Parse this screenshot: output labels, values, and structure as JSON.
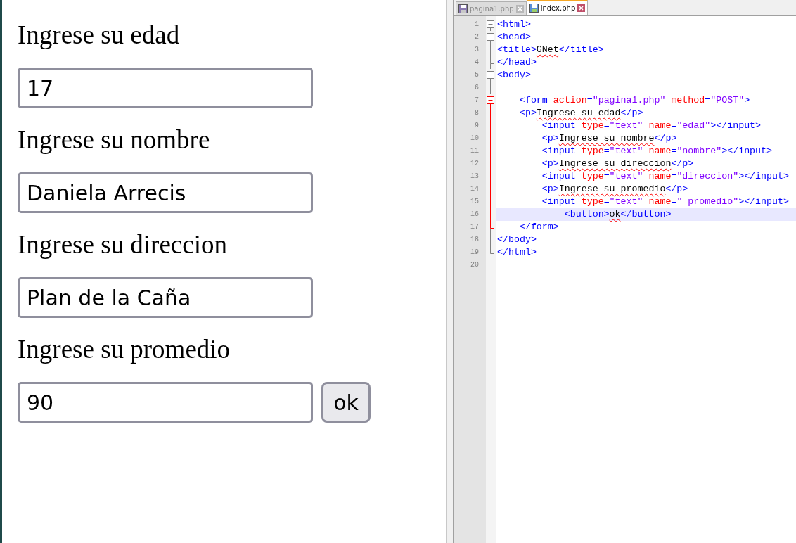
{
  "form": {
    "fields": [
      {
        "label": "Ingrese su edad",
        "value": "17"
      },
      {
        "label": "Ingrese su nombre",
        "value": "Daniela Arrecis"
      },
      {
        "label": "Ingrese su direccion",
        "value": "Plan de la Caña"
      },
      {
        "label": "Ingrese su promedio",
        "value": "90"
      }
    ],
    "button": "ok"
  },
  "editor": {
    "tabs": [
      {
        "label": "pagina1.php",
        "selected": false
      },
      {
        "label": "index.php",
        "selected": true
      }
    ],
    "lines": [
      {
        "number": "1",
        "kind": "fold-open",
        "color": "#808080",
        "selected": false,
        "tokens": [
          {
            "kind": "tag",
            "text": "<html>"
          }
        ]
      },
      {
        "number": "2",
        "kind": "fold-open",
        "color": "#808080",
        "selected": false,
        "tokens": [
          {
            "kind": "tag",
            "text": "<head>"
          }
        ]
      },
      {
        "number": "3",
        "kind": "fold-guide",
        "color": "#808080",
        "selected": false,
        "tokens": [
          {
            "kind": "tag",
            "text": "<title>"
          },
          {
            "kind": "text",
            "text": "GNet"
          },
          {
            "kind": "tag",
            "text": "</title>"
          }
        ]
      },
      {
        "number": "4",
        "kind": "fold-end",
        "color": "#808080",
        "selected": false,
        "tokens": [
          {
            "kind": "tag",
            "text": "</head>"
          }
        ]
      },
      {
        "number": "5",
        "kind": "fold-open",
        "color": "#808080",
        "selected": false,
        "tokens": [
          {
            "kind": "tag",
            "text": "<body>"
          }
        ]
      },
      {
        "number": "6",
        "kind": "fold-guide",
        "color": "#808080",
        "selected": false
      },
      {
        "number": "7",
        "kind": "fold-open",
        "color": "#ff0000",
        "selected": false,
        "tokens": [
          {
            "kind": "tag",
            "text": "    <form "
          },
          {
            "kind": "attr",
            "text": "action"
          },
          {
            "kind": "tag",
            "text": "="
          },
          {
            "kind": "value",
            "text": "\"pagina1.php\" "
          },
          {
            "kind": "attr",
            "text": "method"
          },
          {
            "kind": "tag",
            "text": "="
          },
          {
            "kind": "value",
            "text": "\"POST\""
          },
          {
            "kind": "tag",
            "text": ">"
          }
        ]
      },
      {
        "number": "8",
        "kind": "fold-guide",
        "color": "#ff0000",
        "selected": false,
        "tokens": [
          {
            "kind": "tag",
            "text": "    <p>"
          },
          {
            "kind": "text",
            "text": "Ingrese su edad"
          },
          {
            "kind": "tag",
            "text": "</p>"
          }
        ]
      },
      {
        "number": "9",
        "kind": "fold-guide",
        "color": "#ff0000",
        "selected": false,
        "tokens": [
          {
            "kind": "tag",
            "text": "        <input "
          },
          {
            "kind": "attr",
            "text": "type"
          },
          {
            "kind": "tag",
            "text": "="
          },
          {
            "kind": "value",
            "text": "\"text\" "
          },
          {
            "kind": "attr",
            "text": "name"
          },
          {
            "kind": "tag",
            "text": "="
          },
          {
            "kind": "value",
            "text": "\"edad\""
          },
          {
            "kind": "tag",
            "text": "></input>"
          }
        ]
      },
      {
        "number": "10",
        "kind": "fold-guide",
        "color": "#ff0000",
        "selected": false,
        "tokens": [
          {
            "kind": "tag",
            "text": "        <p>"
          },
          {
            "kind": "text",
            "text": "Ingrese su nombre"
          },
          {
            "kind": "tag",
            "text": "</p>"
          }
        ]
      },
      {
        "number": "11",
        "kind": "fold-guide",
        "color": "#ff0000",
        "selected": false,
        "tokens": [
          {
            "kind": "tag",
            "text": "        <input "
          },
          {
            "kind": "attr",
            "text": "type"
          },
          {
            "kind": "tag",
            "text": "="
          },
          {
            "kind": "value",
            "text": "\"text\" "
          },
          {
            "kind": "attr",
            "text": "name"
          },
          {
            "kind": "tag",
            "text": "="
          },
          {
            "kind": "value",
            "text": "\"nombre\""
          },
          {
            "kind": "tag",
            "text": "></input>"
          }
        ]
      },
      {
        "number": "12",
        "kind": "fold-guide",
        "color": "#ff0000",
        "selected": false,
        "tokens": [
          {
            "kind": "tag",
            "text": "        <p>"
          },
          {
            "kind": "text",
            "text": "Ingrese su direccion"
          },
          {
            "kind": "tag",
            "text": "</p>"
          }
        ]
      },
      {
        "number": "13",
        "kind": "fold-guide",
        "color": "#ff0000",
        "selected": false,
        "tokens": [
          {
            "kind": "tag",
            "text": "        <input "
          },
          {
            "kind": "attr",
            "text": "type"
          },
          {
            "kind": "tag",
            "text": "="
          },
          {
            "kind": "value",
            "text": "\"text\" "
          },
          {
            "kind": "attr",
            "text": "name"
          },
          {
            "kind": "tag",
            "text": "="
          },
          {
            "kind": "value",
            "text": "\"direccion\""
          },
          {
            "kind": "tag",
            "text": "></input>"
          }
        ]
      },
      {
        "number": "14",
        "kind": "fold-guide",
        "color": "#ff0000",
        "selected": false,
        "tokens": [
          {
            "kind": "tag",
            "text": "        <p>"
          },
          {
            "kind": "text",
            "text": "Ingrese su promedio"
          },
          {
            "kind": "tag",
            "text": "</p>"
          }
        ]
      },
      {
        "number": "15",
        "kind": "fold-guide",
        "color": "#ff0000",
        "selected": false,
        "tokens": [
          {
            "kind": "tag",
            "text": "        <input "
          },
          {
            "kind": "attr",
            "text": "type"
          },
          {
            "kind": "tag",
            "text": "="
          },
          {
            "kind": "value",
            "text": "\"text\" "
          },
          {
            "kind": "attr",
            "text": "name"
          },
          {
            "kind": "tag",
            "text": "="
          },
          {
            "kind": "value",
            "text": "\" promedio\""
          },
          {
            "kind": "tag",
            "text": "></input>"
          }
        ]
      },
      {
        "number": "16",
        "kind": "fold-guide",
        "color": "#ff0000",
        "selected": true,
        "tokens": [
          {
            "kind": "tag",
            "text": "            <button>"
          },
          {
            "kind": "text",
            "text": "ok"
          },
          {
            "kind": "tag",
            "text": "</button>"
          }
        ]
      },
      {
        "number": "17",
        "kind": "fold-end",
        "color": "#ff0000",
        "selected": false,
        "tokens": [
          {
            "kind": "tag",
            "text": "    </form>"
          }
        ]
      },
      {
        "number": "18",
        "kind": "fold-end",
        "color": "#808080",
        "selected": false,
        "tokens": [
          {
            "kind": "tag",
            "text": "</body>"
          }
        ]
      },
      {
        "number": "19",
        "kind": "fold-end",
        "color": "#808080",
        "selected": false,
        "tokens": [
          {
            "kind": "tag",
            "text": "</html>"
          }
        ]
      },
      {
        "number": "20",
        "kind": "plain",
        "selected": false
      }
    ]
  }
}
